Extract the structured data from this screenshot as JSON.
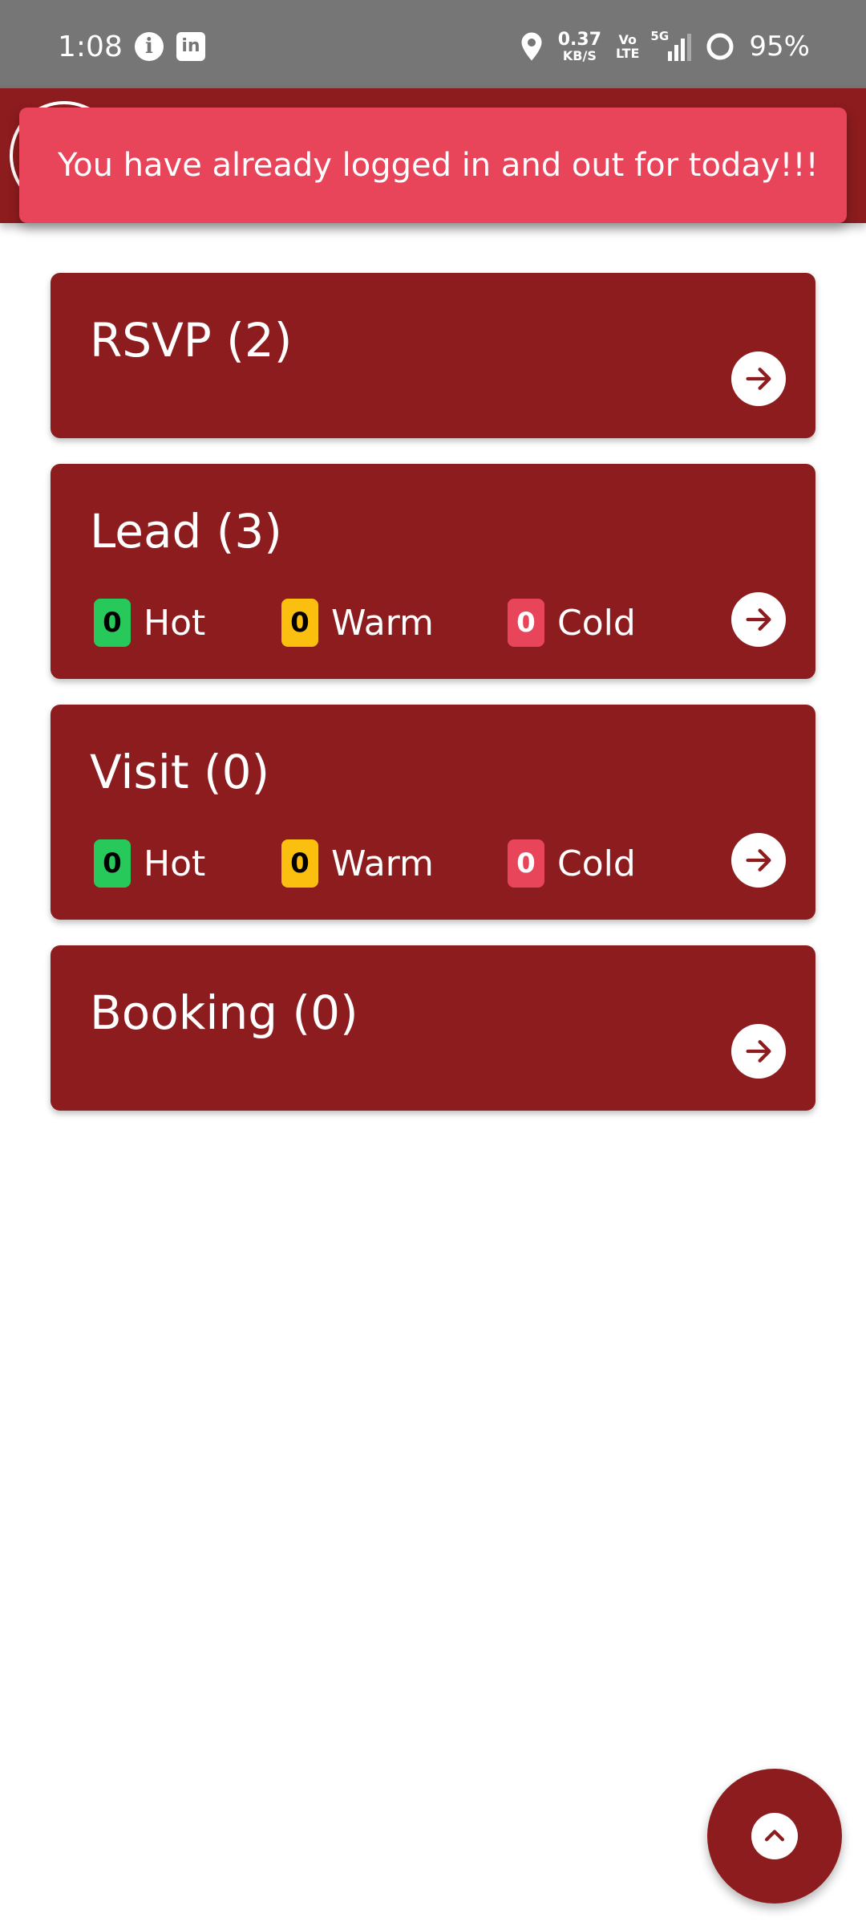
{
  "status_bar": {
    "time": "1:08",
    "info_icon": "info-icon",
    "linkedin_icon": "linkedin-icon",
    "linkedin_text": "in",
    "location_icon": "location-pin-icon",
    "speed_value": "0.37",
    "speed_unit": "KB/S",
    "volte_top": "Vo",
    "volte_bottom": "LTE",
    "network": "5G",
    "battery": "95%"
  },
  "toast": {
    "message": "You have already logged in and out for today!!!"
  },
  "colors": {
    "primary": "#8c1c1e",
    "toast": "#e8455b",
    "hot": "#27c95b",
    "warm": "#fbbf0f",
    "cold": "#e8455b"
  },
  "cards": [
    {
      "title": "RSVP (2)"
    },
    {
      "title": "Lead (3)",
      "hot_count": "0",
      "hot_label": "Hot",
      "warm_count": "0",
      "warm_label": "Warm",
      "cold_count": "0",
      "cold_label": "Cold"
    },
    {
      "title": "Visit (0)",
      "hot_count": "0",
      "hot_label": "Hot",
      "warm_count": "0",
      "warm_label": "Warm",
      "cold_count": "0",
      "cold_label": "Cold"
    },
    {
      "title": "Booking (0)"
    }
  ],
  "fab": {
    "icon": "chevron-up-icon"
  }
}
